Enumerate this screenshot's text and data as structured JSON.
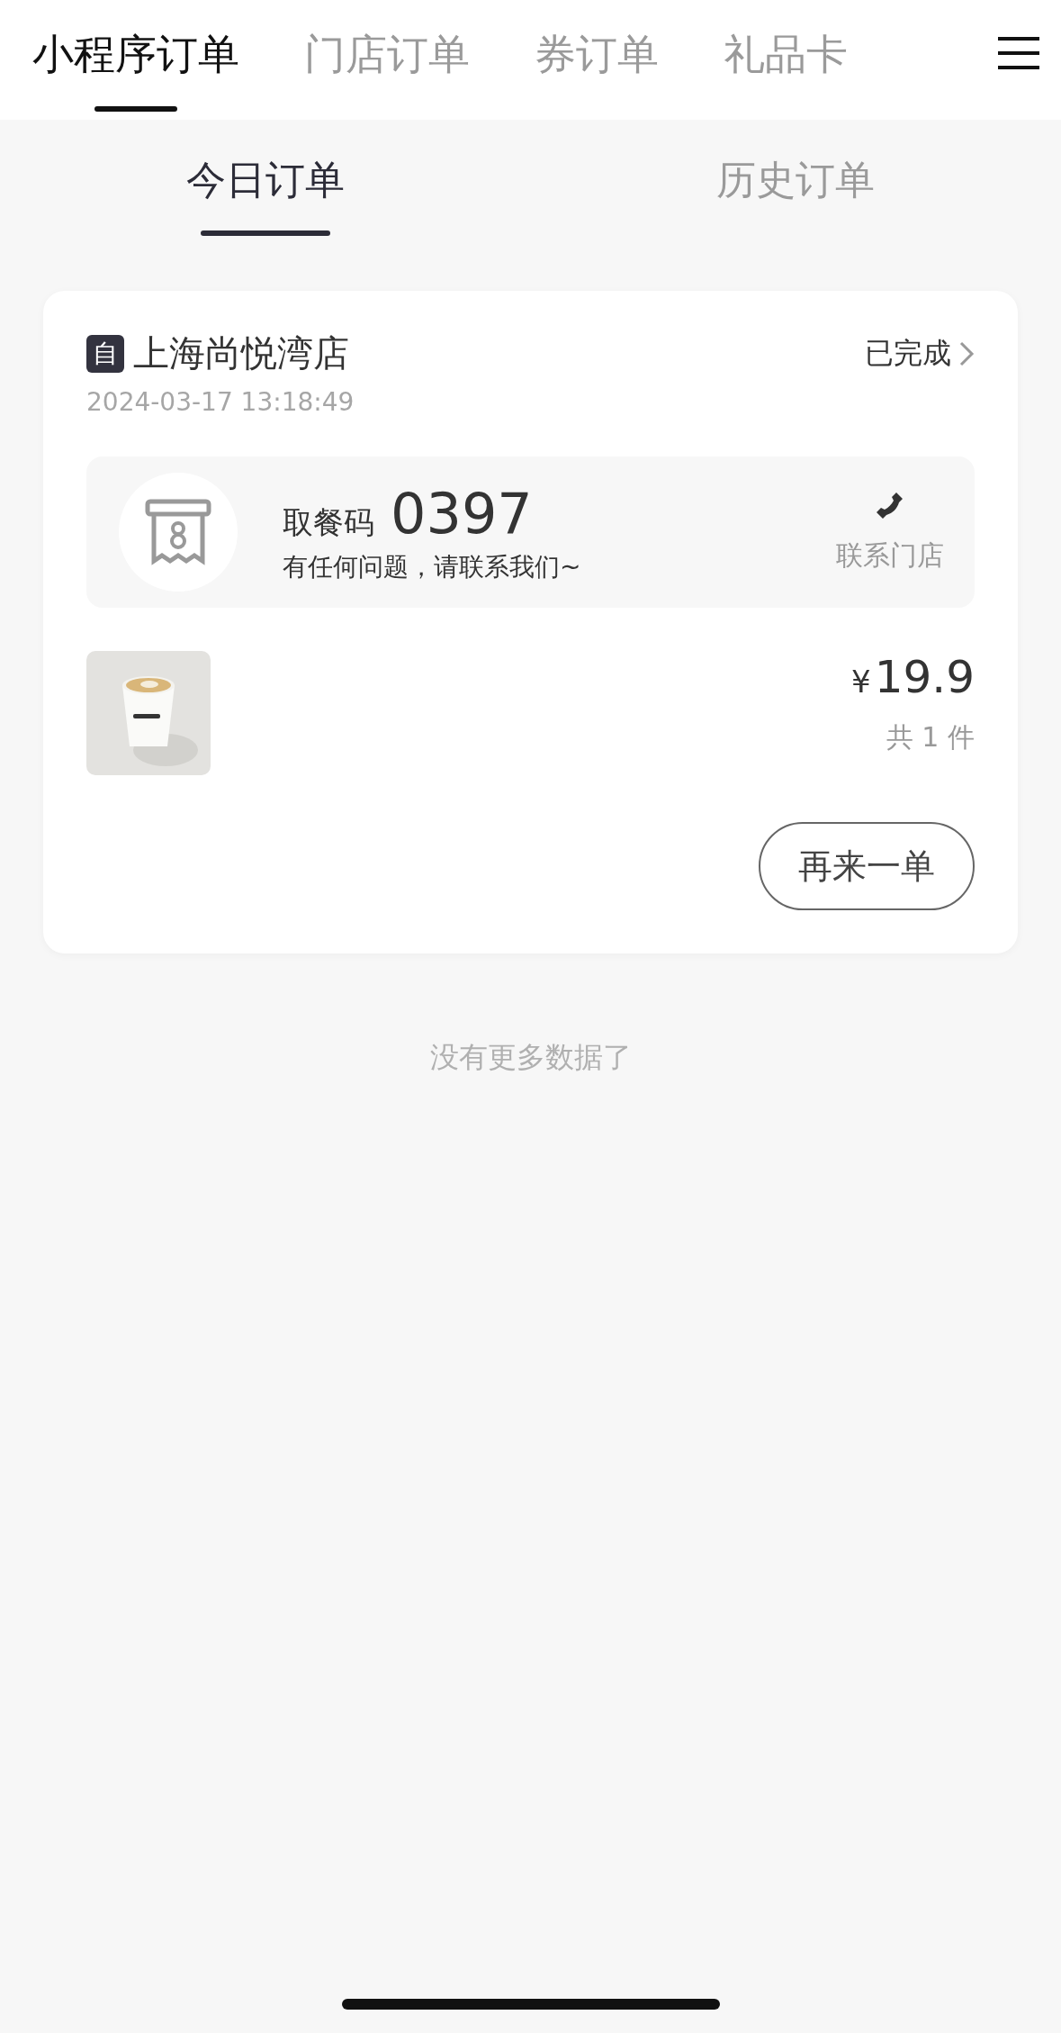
{
  "top_tabs": [
    {
      "label": "小程序订单",
      "selected": true
    },
    {
      "label": "门店订单",
      "selected": false
    },
    {
      "label": "券订单",
      "selected": false
    },
    {
      "label": "礼品卡",
      "selected": false
    }
  ],
  "sub_tabs": [
    {
      "label": "今日订单",
      "selected": true
    },
    {
      "label": "历史订单",
      "selected": false
    }
  ],
  "orders": [
    {
      "badge": "自",
      "store": "上海尚悦湾店",
      "status": "已完成",
      "time": "2024-03-17 13:18:49",
      "pickup_label": "取餐码",
      "pickup_code": "0397",
      "help_text": "有任何问题，请联系我们~",
      "contact_label": "联系门店",
      "price_symbol": "¥",
      "price": "19.9",
      "count": "共 1 件",
      "reorder_button": "再来一单"
    }
  ],
  "footer_text": "没有更多数据了"
}
